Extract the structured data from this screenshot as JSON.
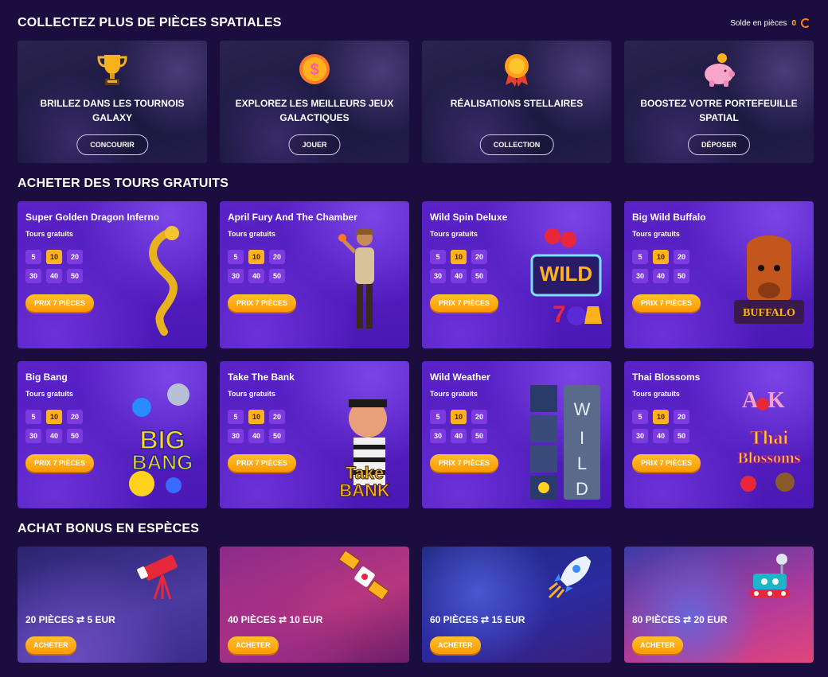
{
  "header": {
    "title": "COLLECTEZ PLUS DE PIÈCES SPATIALES",
    "balance_label": "Solde en pièces",
    "balance_value": "0"
  },
  "top_cards": [
    {
      "label": "BRILLEZ DANS LES TOURNOIS GALAXY",
      "button": "CONCOURIR",
      "icon": "trophy-icon"
    },
    {
      "label": "EXPLOREZ LES MEILLEURS JEUX GALACTIQUES",
      "button": "JOUER",
      "icon": "coin-icon"
    },
    {
      "label": "RÉALISATIONS STELLAIRES",
      "button": "COLLECTION",
      "icon": "medal-icon"
    },
    {
      "label": "BOOSTEZ VOTRE PORTEFEUILLE SPATIAL",
      "button": "DÉPOSER",
      "icon": "piggy-bank-icon"
    }
  ],
  "free_spins": {
    "title": "ACHETER DES TOURS GRATUITS",
    "spins_label": "Tours gratuits",
    "options": [
      "5",
      "10",
      "20",
      "30",
      "40",
      "50"
    ],
    "selected": "10",
    "price_label": "PRIX 7 PIÈCES",
    "games": [
      {
        "name": "Super Golden Dragon Inferno",
        "icon": "golden-dragon-icon"
      },
      {
        "name": "April Fury And The Chamber",
        "icon": "adventurer-icon"
      },
      {
        "name": "Wild Spin Deluxe",
        "icon": "wild-cherries-icon"
      },
      {
        "name": "Big Wild Buffalo",
        "icon": "buffalo-icon"
      },
      {
        "name": "Big Bang",
        "icon": "planets-icon"
      },
      {
        "name": "Take The Bank",
        "icon": "robber-icon"
      },
      {
        "name": "Wild Weather",
        "icon": "weather-icon"
      },
      {
        "name": "Thai Blossoms",
        "icon": "blossoms-icon"
      }
    ]
  },
  "bonus": {
    "title": "ACHAT BONUS EN ESPÈCES",
    "button": "ACHETER",
    "items": [
      {
        "coins": "20 PIÈCES",
        "arrow": "⇄",
        "amount": "5 EUR",
        "icon": "telescope-icon"
      },
      {
        "coins": "40 PIÈCES",
        "arrow": "⇄",
        "amount": "10 EUR",
        "icon": "satellite-icon"
      },
      {
        "coins": "60 PIÈCES",
        "arrow": "⇄",
        "amount": "15 EUR",
        "icon": "rocket-icon"
      },
      {
        "coins": "80 PIÈCES",
        "arrow": "⇄",
        "amount": "20 EUR",
        "icon": "rover-icon"
      }
    ]
  },
  "colors": {
    "background": "#1c0d3f",
    "card_purple": "#5a22c8",
    "accent_orange": "#ffb21e"
  }
}
